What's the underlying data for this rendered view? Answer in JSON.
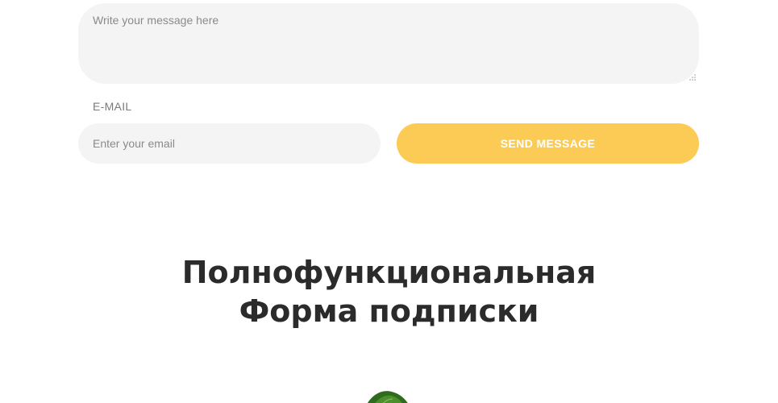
{
  "contact_form": {
    "message_placeholder": "Write your message here",
    "email_label": "E-MAIL",
    "email_placeholder": "Enter your email",
    "send_label": "SEND MESSAGE",
    "accent_color": "#fbcb56",
    "field_background": "#f4f4f4"
  },
  "subscribe_section": {
    "title_line1": "Полнофункциональная",
    "title_line2": "Форма подписки"
  },
  "decoration": {
    "icon": "green-leaf-icon"
  }
}
